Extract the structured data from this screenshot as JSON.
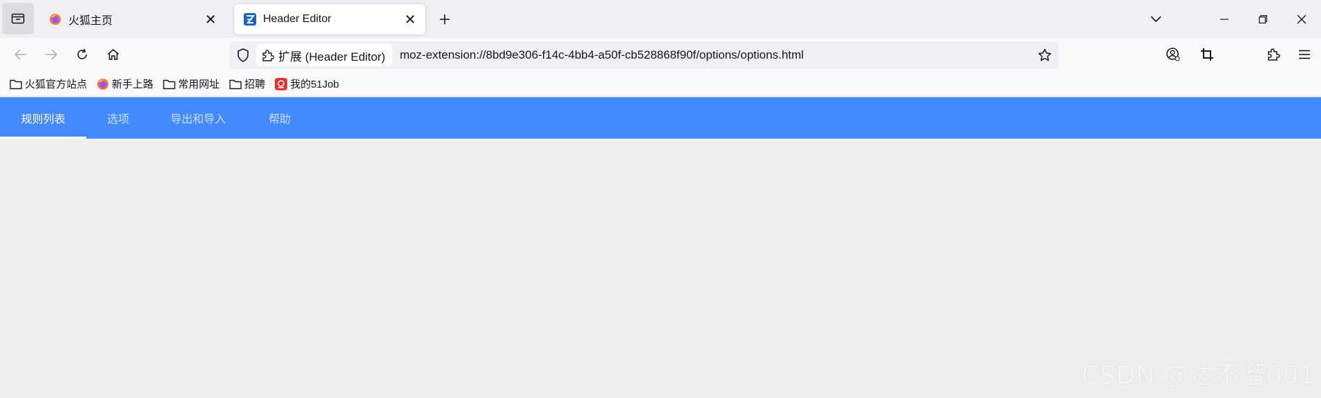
{
  "browser": {
    "tabs": [
      {
        "title": "火狐主页",
        "icon": "firefox-icon",
        "active": false
      },
      {
        "title": "Header Editor",
        "icon": "header-editor-icon",
        "active": true
      }
    ],
    "close_glyph": "✕"
  },
  "navbar": {
    "extension_chip": "扩展 (Header Editor)",
    "url": "moz-extension://8bd9e306-f14c-4bb4-a50f-cb528868f90f/options/options.html"
  },
  "bookmarks": [
    {
      "label": "火狐官方站点",
      "icon": "folder-icon"
    },
    {
      "label": "新手上路",
      "icon": "firefox-icon"
    },
    {
      "label": "常用网址",
      "icon": "folder-icon"
    },
    {
      "label": "招聘",
      "icon": "folder-icon"
    },
    {
      "label": "我的51Job",
      "icon": "51job-icon"
    }
  ],
  "app": {
    "tabs": [
      "规则列表",
      "选项",
      "导出和导入",
      "帮助"
    ],
    "selected_tab": "规则列表",
    "accent_color": "#448aff"
  },
  "watermark": "CSDN @达不溜001"
}
